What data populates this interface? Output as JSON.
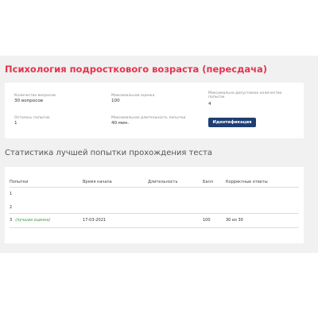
{
  "test_title": "Психология подросткового возраста (пересдача)",
  "info": {
    "questions_count_label": "Количество вопросов",
    "questions_count_value": "30 вопросов",
    "max_score_label": "Максимальная оценка",
    "max_score_value": "100",
    "max_attempts_label": "Максимально допустимое количество попыток",
    "max_attempts_value": "4",
    "attempts_left_label": "Осталось попыток",
    "attempts_left_value": "1",
    "max_duration_label": "Максимальная длительность попытки",
    "max_duration_value": "40 мин.",
    "identification_button": "Идентификация"
  },
  "stats": {
    "title": "Статистика лучшей попытки прохождения теста",
    "columns": [
      "Попытки",
      "Время начала",
      "Длительность",
      "Балл",
      "Корректные ответы"
    ],
    "rows": [
      {
        "attempt": "1",
        "best_label": "",
        "start_time": "",
        "duration": "",
        "score": "",
        "correct": ""
      },
      {
        "attempt": "2",
        "best_label": "",
        "start_time": "",
        "duration": "",
        "score": "",
        "correct": ""
      },
      {
        "attempt": "3",
        "best_label": "(лучшая оценка)",
        "start_time": "17-03-2021",
        "duration": "",
        "score": "100",
        "correct": "30 из 30"
      }
    ]
  },
  "colors": {
    "title_red": "#e5334f",
    "button_blue": "#1f3f73",
    "best_green": "#3a9a3a",
    "page_bg": "#f1f1f1"
  }
}
